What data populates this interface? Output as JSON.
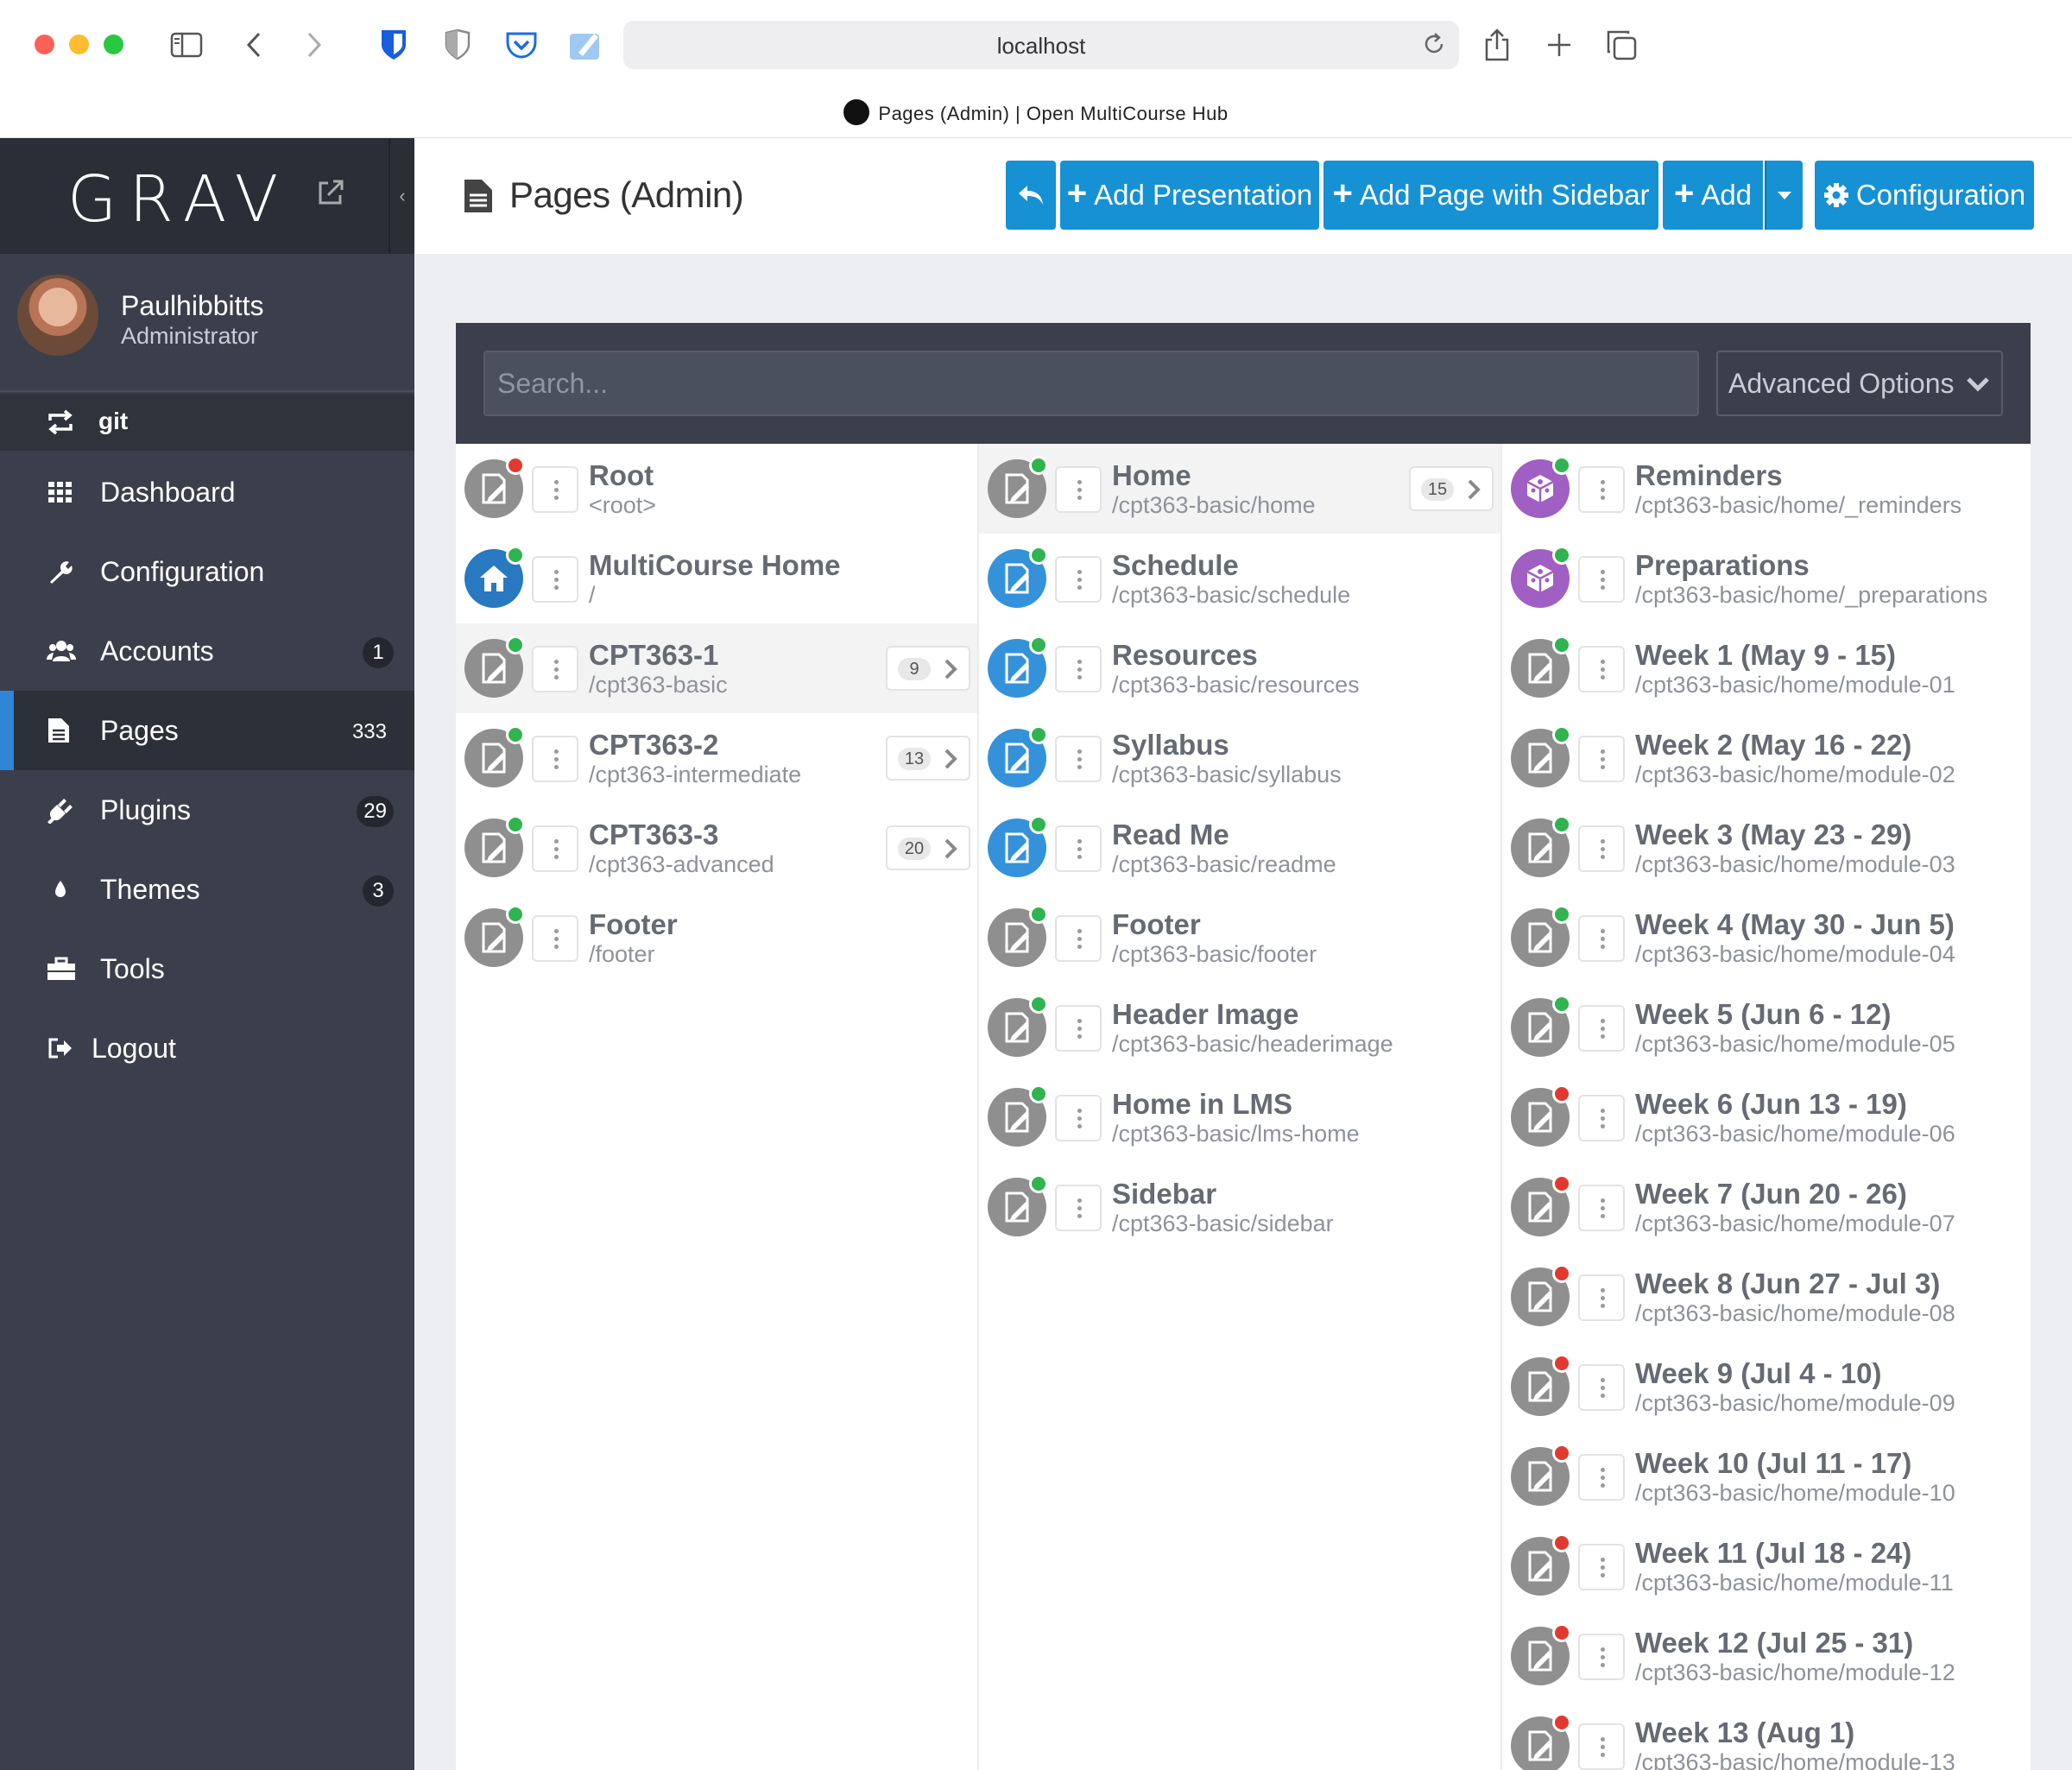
{
  "browser": {
    "url": "localhost",
    "tab_title": "Pages (Admin) | Open MultiCourse Hub"
  },
  "sidebar": {
    "logo": "GRAV",
    "user": {
      "name": "Paulhibbitts",
      "role": "Administrator"
    },
    "git_label": "git",
    "items": [
      {
        "label": "Dashboard",
        "badge": "",
        "icon": "grid-icon"
      },
      {
        "label": "Configuration",
        "badge": "",
        "icon": "wrench-icon"
      },
      {
        "label": "Accounts",
        "badge": "1",
        "icon": "users-icon"
      },
      {
        "label": "Pages",
        "badge": "333",
        "icon": "file-icon",
        "active": true
      },
      {
        "label": "Plugins",
        "badge": "29",
        "icon": "plug-icon"
      },
      {
        "label": "Themes",
        "badge": "3",
        "icon": "tint-icon"
      },
      {
        "label": "Tools",
        "badge": "",
        "icon": "briefcase-icon"
      },
      {
        "label": "Logout",
        "badge": "",
        "icon": "sign-out-icon"
      }
    ]
  },
  "header": {
    "title": "Pages (Admin)",
    "buttons": {
      "add_presentation": "Add Presentation",
      "add_page_sidebar": "Add Page with Sidebar",
      "add": "Add",
      "configuration": "Configuration"
    }
  },
  "search": {
    "placeholder": "Search...",
    "advanced": "Advanced Options"
  },
  "colors": {
    "accent": "#1691d3",
    "sidebar": "#3b3f4b",
    "status_published": "#2fb44f",
    "status_unpublished": "#e2392f"
  },
  "columns": [
    [
      {
        "title": "Root",
        "path": "<root>",
        "status": "red",
        "icon": "gray",
        "count": ""
      },
      {
        "title": "MultiCourse Home",
        "path": "/",
        "status": "green",
        "icon": "home",
        "count": ""
      },
      {
        "title": "CPT363-1",
        "path": "/cpt363-basic",
        "status": "green",
        "icon": "gray",
        "count": "9",
        "selected": true
      },
      {
        "title": "CPT363-2",
        "path": "/cpt363-intermediate",
        "status": "green",
        "icon": "gray",
        "count": "13"
      },
      {
        "title": "CPT363-3",
        "path": "/cpt363-advanced",
        "status": "green",
        "icon": "gray",
        "count": "20"
      },
      {
        "title": "Footer",
        "path": "/footer",
        "status": "green",
        "icon": "gray",
        "count": ""
      }
    ],
    [
      {
        "title": "Home",
        "path": "/cpt363-basic/home",
        "status": "green",
        "icon": "gray",
        "count": "15",
        "selected": true
      },
      {
        "title": "Schedule",
        "path": "/cpt363-basic/schedule",
        "status": "green",
        "icon": "blue",
        "count": ""
      },
      {
        "title": "Resources",
        "path": "/cpt363-basic/resources",
        "status": "green",
        "icon": "blue",
        "count": ""
      },
      {
        "title": "Syllabus",
        "path": "/cpt363-basic/syllabus",
        "status": "green",
        "icon": "blue",
        "count": ""
      },
      {
        "title": "Read Me",
        "path": "/cpt363-basic/readme",
        "status": "green",
        "icon": "blue",
        "count": ""
      },
      {
        "title": "Footer",
        "path": "/cpt363-basic/footer",
        "status": "green",
        "icon": "gray",
        "count": ""
      },
      {
        "title": "Header Image",
        "path": "/cpt363-basic/headerimage",
        "status": "green",
        "icon": "gray",
        "count": ""
      },
      {
        "title": "Home in LMS",
        "path": "/cpt363-basic/lms-home",
        "status": "green",
        "icon": "gray",
        "count": ""
      },
      {
        "title": "Sidebar",
        "path": "/cpt363-basic/sidebar",
        "status": "green",
        "icon": "gray",
        "count": ""
      }
    ],
    [
      {
        "title": "Reminders",
        "path": "/cpt363-basic/home/_reminders",
        "status": "green",
        "icon": "purple",
        "count": ""
      },
      {
        "title": "Preparations",
        "path": "/cpt363-basic/home/_preparations",
        "status": "green",
        "icon": "purple",
        "count": ""
      },
      {
        "title": "Week 1 (May 9 - 15)",
        "path": "/cpt363-basic/home/module-01",
        "status": "green",
        "icon": "gray",
        "count": ""
      },
      {
        "title": "Week 2 (May 16 - 22)",
        "path": "/cpt363-basic/home/module-02",
        "status": "green",
        "icon": "gray",
        "count": ""
      },
      {
        "title": "Week 3 (May 23 - 29)",
        "path": "/cpt363-basic/home/module-03",
        "status": "green",
        "icon": "gray",
        "count": ""
      },
      {
        "title": "Week 4 (May 30 - Jun 5)",
        "path": "/cpt363-basic/home/module-04",
        "status": "green",
        "icon": "gray",
        "count": ""
      },
      {
        "title": "Week 5 (Jun 6 - 12)",
        "path": "/cpt363-basic/home/module-05",
        "status": "green",
        "icon": "gray",
        "count": ""
      },
      {
        "title": "Week 6 (Jun 13 - 19)",
        "path": "/cpt363-basic/home/module-06",
        "status": "red",
        "icon": "gray",
        "count": ""
      },
      {
        "title": "Week 7 (Jun 20 - 26)",
        "path": "/cpt363-basic/home/module-07",
        "status": "red",
        "icon": "gray",
        "count": ""
      },
      {
        "title": "Week 8 (Jun 27 - Jul 3)",
        "path": "/cpt363-basic/home/module-08",
        "status": "red",
        "icon": "gray",
        "count": ""
      },
      {
        "title": "Week 9 (Jul 4 - 10)",
        "path": "/cpt363-basic/home/module-09",
        "status": "red",
        "icon": "gray",
        "count": ""
      },
      {
        "title": "Week 10 (Jul 11 - 17)",
        "path": "/cpt363-basic/home/module-10",
        "status": "red",
        "icon": "gray",
        "count": ""
      },
      {
        "title": "Week 11 (Jul 18 - 24)",
        "path": "/cpt363-basic/home/module-11",
        "status": "red",
        "icon": "gray",
        "count": ""
      },
      {
        "title": "Week 12 (Jul 25 - 31)",
        "path": "/cpt363-basic/home/module-12",
        "status": "red",
        "icon": "gray",
        "count": ""
      },
      {
        "title": "Week 13 (Aug 1)",
        "path": "/cpt363-basic/home/module-13",
        "status": "red",
        "icon": "gray",
        "count": ""
      }
    ]
  ]
}
